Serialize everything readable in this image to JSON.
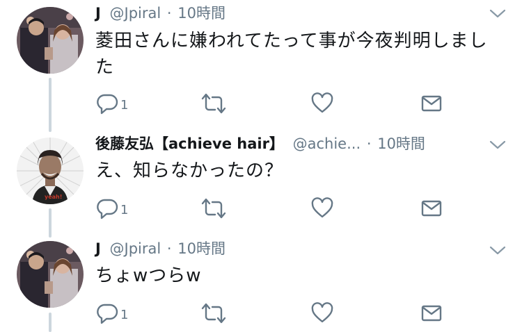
{
  "tweets": [
    {
      "name": "J",
      "handle": "@Jpiral",
      "separator": "·",
      "time": "10時間",
      "text_line1": "菱田さんに嫌われてたって事が今夜判明しまし",
      "text_line2": "た",
      "reply_count": "1"
    },
    {
      "name": "後藤友弘【achieve hair】",
      "handle": "@achie...",
      "separator": "·",
      "time": "10時間",
      "text_line1": "え、知らなかったの？",
      "reply_count": "1"
    },
    {
      "name": "J",
      "handle": "@Jpiral",
      "separator": "·",
      "time": "10時間",
      "text_line1": "ちょwつらw",
      "reply_count": "1"
    }
  ],
  "icons": {
    "reply": "reply-icon",
    "retweet": "retweet-icon",
    "like": "heart-icon",
    "dm": "envelope-icon",
    "caret": "chevron-down-icon"
  },
  "colors": {
    "text": "#14171a",
    "secondary": "#657786",
    "thread_line": "#ccd6dd"
  }
}
